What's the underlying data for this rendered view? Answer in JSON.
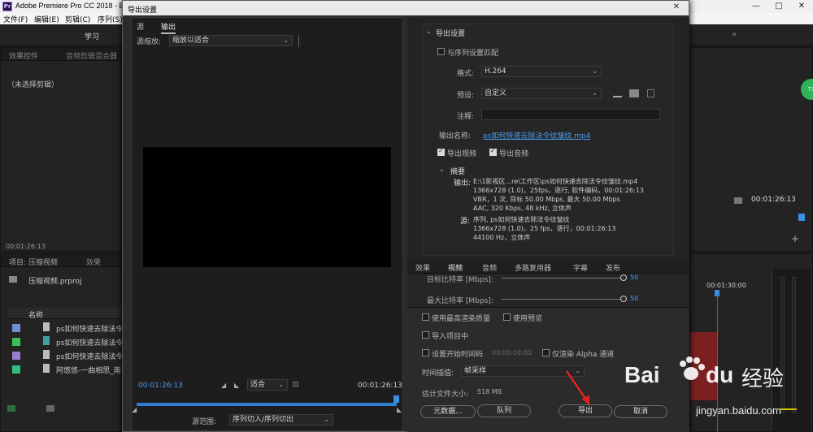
{
  "app": {
    "title": "Adobe Premiere Pro CC 2018 - E",
    "logo": "Pr",
    "win_controls": [
      "—",
      "□",
      "✕"
    ]
  },
  "menu": [
    "文件(F)",
    "编辑(E)",
    "剪辑(C)",
    "序列(S)"
  ],
  "workspace": {
    "label": "学习",
    "overflow": "»"
  },
  "bg_panels": {
    "effect_controls_tab": "效果控件",
    "audio_mixer_tab": "音频剪辑混合器",
    "no_clip": "（未选择剪辑）",
    "timecode_left": "00:01:26:13",
    "project_tab": "项目: 压缩视频",
    "effects_tab": "效果",
    "project_file": "压缩视频.prproj",
    "name_header": "名称",
    "items": [
      {
        "name": "ps如何快速去除法令",
        "color": "#6f8fd6"
      },
      {
        "name": "ps如何快速去除法令",
        "color": "#3fbf5a"
      },
      {
        "name": "ps如何快速去除法令",
        "color": "#9a7fd0"
      },
      {
        "name": "阿悠悠-一曲相思_雨",
        "color": "#2fc07a"
      }
    ],
    "program_timecode": "00:01:26:13",
    "ruler_time": "00:01:30:00",
    "badge": "73",
    "plus": "+"
  },
  "dialog": {
    "title": "导出设置",
    "close": "✕",
    "left": {
      "tabs": [
        "源",
        "输出"
      ],
      "source_scaling_label": "源缩放:",
      "source_scaling_value": "缩放以适合",
      "timecode_in": "00:01:26:13",
      "timecode_out": "00:01:26:13",
      "fit_value": "适合",
      "source_range_label": "源范围:",
      "source_range_value": "序列切入/序列切出"
    },
    "export_settings": {
      "header": "导出设置",
      "match_sequence": "与序列设置匹配",
      "format_label": "格式:",
      "format_value": "H.264",
      "preset_label": "预设:",
      "preset_value": "自定义",
      "comments_label": "注释:",
      "comments_value": "",
      "output_name_label": "输出名称:",
      "output_name_value": "ps如何快速去除法令纹皱纹.mp4",
      "export_video": "导出视频",
      "export_audio": "导出音频"
    },
    "summary": {
      "header": "摘要",
      "output_label": "输出:",
      "output_lines": [
        "E:\\1影视区...re\\工作区\\ps如何快速去除法令纹皱纹.mp4",
        "1366x728 (1.0)，25fps，逐行, 软件编码，00:01:26:13",
        "VBR，1 次, 目标 50.00 Mbps, 最大 50.00 Mbps",
        "AAC, 320 Kbps, 48  kHz, 立体声"
      ],
      "source_label": "源:",
      "source_lines": [
        "序列, ps如何快速去除法令纹皱纹",
        "1366x728 (1.0)，25 fps，逐行，00:01:26:13",
        "44100 Hz，立体声"
      ]
    },
    "tabs2": [
      "效果",
      "视频",
      "音频",
      "多路复用器",
      "字幕",
      "发布"
    ],
    "bitrate": {
      "target_label": "目标比特率 [Mbps]:",
      "target_value": "50",
      "max_label": "最大比特率 [Mbps]:",
      "max_value": "50"
    },
    "options": {
      "max_render_quality": "使用最高渲染质量",
      "use_previews": "使用预览",
      "import_into_project": "导入项目中",
      "set_start_timecode": "设置开始时间码",
      "start_timecode_value": "00:00:00:00",
      "render_alpha_only": "仅渲染 Alpha 通道",
      "time_interp_label": "时间插值:",
      "time_interp_value": "帧采样",
      "est_size_label": "估计文件大小:",
      "est_size_value": "518 MB"
    },
    "buttons": {
      "metadata": "元数据...",
      "queue": "队列",
      "export": "导出",
      "cancel": "取消"
    }
  },
  "watermark": {
    "brand": "Bai",
    "brand2": "du",
    "cn": "经验",
    "url": "jingyan.baidu.com"
  }
}
